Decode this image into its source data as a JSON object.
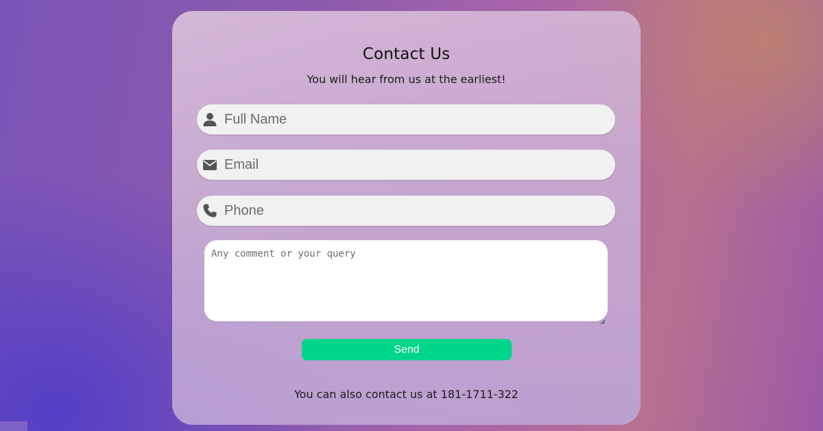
{
  "form": {
    "title": "Contact Us",
    "subtitle": "You will hear from us at the earliest!",
    "fields": {
      "name": {
        "placeholder": "Full Name",
        "value": "",
        "icon": "user-icon"
      },
      "email": {
        "placeholder": "Email",
        "value": "",
        "icon": "envelope-icon"
      },
      "phone": {
        "placeholder": "Phone",
        "value": "",
        "icon": "phone-icon"
      }
    },
    "comment": {
      "placeholder": "Any comment or your query",
      "value": ""
    },
    "send_label": "Send",
    "footer": "You can also contact us at 181-1711-322"
  },
  "colors": {
    "send_button": "#00d68a",
    "field_background": "#f1f1f1",
    "icon": "#555555"
  }
}
